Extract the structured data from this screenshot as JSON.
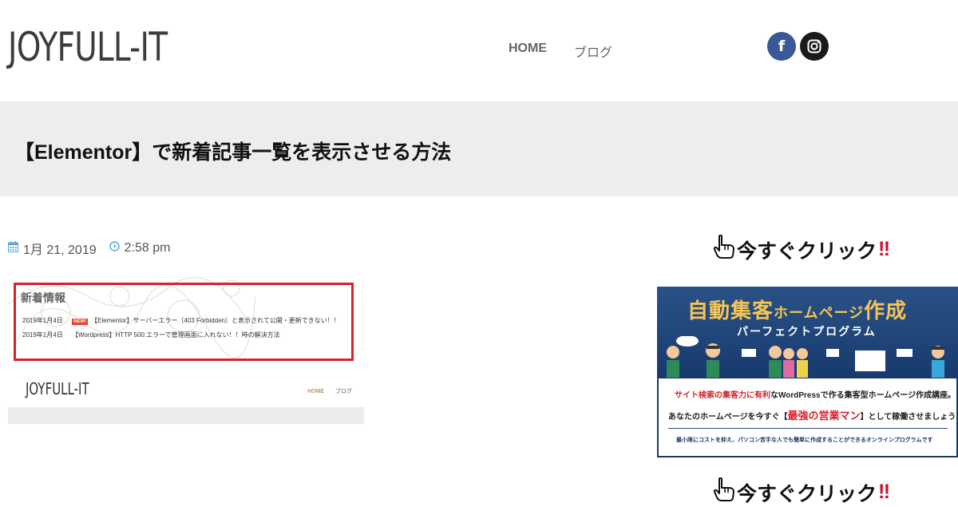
{
  "header": {
    "logo": "JOYFULL-IT",
    "nav": [
      {
        "label": "HOME"
      },
      {
        "label": "ブログ"
      }
    ],
    "social": [
      {
        "icon": "facebook-icon",
        "glyph": "f",
        "color": "#3b5998"
      },
      {
        "icon": "instagram-icon",
        "color": "#1a1a1a"
      }
    ]
  },
  "page": {
    "title": "【Elementor】で新着記事一覧を表示させる方法"
  },
  "post": {
    "date": "1月 21, 2019",
    "time": "2:58 pm",
    "featured": {
      "section_title": "新着情報",
      "rows": [
        {
          "date": "2019年1月4日",
          "badge": "NEW!",
          "text": "【Elementor】サーバーエラー（403 Forbidden）と表示されて公開・更新できない！！"
        },
        {
          "date": "2019年1月4日",
          "text": "【Wordpress】HTTP 500:エラーで管理画面に入れない！！時の解決方法"
        }
      ],
      "mini_logo": "JOYFULL-IT",
      "mini_nav": [
        "HOME",
        "ブログ"
      ]
    }
  },
  "sidebar": {
    "heading": "今すぐクリック",
    "heading_bang": "‼",
    "banner": {
      "title_main": "自動集客",
      "title_small": "ホームページ",
      "title_end": "作成",
      "subtitle": "パーフェクトプログラム",
      "line1_red": "サイト検索の集客力に有利",
      "line1_rest": "なWordPressで作る集客型ホームページ作成講座。",
      "line2_a": "あなたのホームページを今すぐ【",
      "line2_red": "最強の営業マン",
      "line2_b": "】として稼働させましょう！",
      "line3": "最小限にコストを抑え、パソコン苦手な人でも簡単に作成することができるオンラインプログラムです"
    },
    "heading2": "今すぐクリック",
    "heading2_bang": "‼"
  },
  "colors": {
    "title_band": "#ededed",
    "accent_red": "#d8212a",
    "facebook": "#3b5998",
    "meta_icon": "#5aa9d6"
  }
}
